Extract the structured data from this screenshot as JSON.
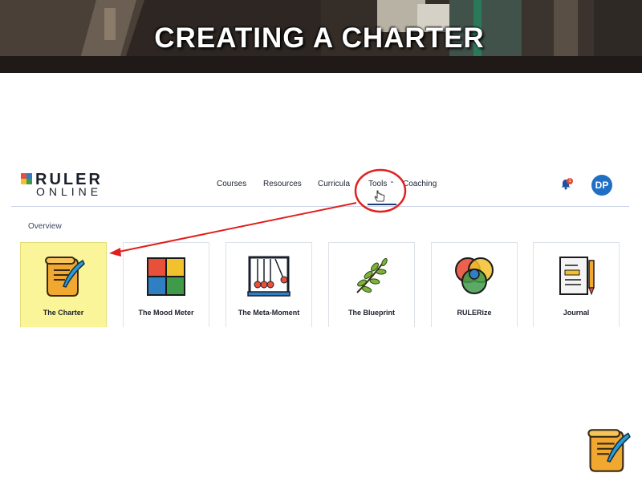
{
  "slide": {
    "title": "CREATING A CHARTER"
  },
  "app": {
    "logo": {
      "line1": "RULER",
      "line2": "ONLINE"
    },
    "nav": {
      "courses": "Courses",
      "resources": "Resources",
      "curricula": "Curricula",
      "tools": "Tools",
      "coaching": "Coaching"
    },
    "notifications": {
      "count": "1"
    },
    "user": {
      "initials": "DP"
    },
    "subnav": {
      "overview": "Overview"
    },
    "tools": [
      {
        "label": "The Charter",
        "icon": "scroll-quill-icon",
        "selected": true
      },
      {
        "label": "The Mood Meter",
        "icon": "mood-meter-grid-icon"
      },
      {
        "label": "The Meta-Moment",
        "icon": "newtons-cradle-icon"
      },
      {
        "label": "The Blueprint",
        "icon": "laurel-branch-icon"
      },
      {
        "label": "RULERize",
        "icon": "venn-circles-icon"
      },
      {
        "label": "Journal",
        "icon": "journal-pencil-icon"
      }
    ]
  },
  "colors": {
    "selected_card": "#fbf59a",
    "accent_blue": "#1f6fc5",
    "annotation_red": "#e02020",
    "mood_red": "#e8503a",
    "mood_blue": "#2f7fc2",
    "mood_yellow": "#f2c12e",
    "mood_green": "#3f9a4a"
  }
}
